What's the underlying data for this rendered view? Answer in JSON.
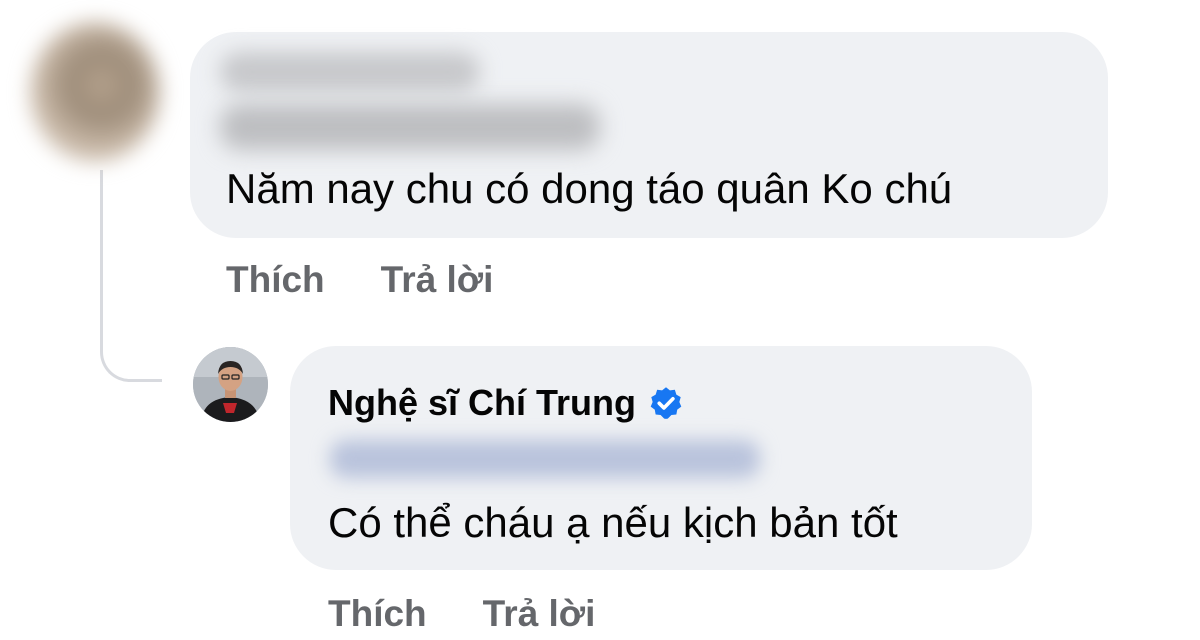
{
  "comment": {
    "text": "Năm nay chu có dong táo quân Ko chú",
    "actions": {
      "like_label": "Thích",
      "reply_label": "Trả lời"
    }
  },
  "reply": {
    "author_name": "Nghệ sĩ Chí Trung",
    "verified_icon": "verified-badge-icon",
    "text": "Có thể cháu ạ nếu kịch bản tốt",
    "actions": {
      "like_label": "Thích",
      "reply_label": "Trả lời"
    }
  },
  "colors": {
    "bubble": "#eff1f4",
    "action_text": "#65676b",
    "verified": "#1877f2",
    "thread_line": "#d8dadf"
  }
}
